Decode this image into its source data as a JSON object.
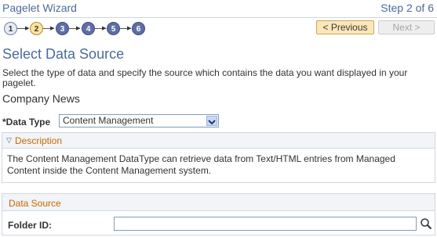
{
  "header": {
    "title": "Pagelet Wizard",
    "step_indicator": "Step 2 of 6"
  },
  "steps": [
    {
      "number": "1",
      "state": "done"
    },
    {
      "number": "2",
      "state": "current"
    },
    {
      "number": "3",
      "state": "todo"
    },
    {
      "number": "4",
      "state": "todo"
    },
    {
      "number": "5",
      "state": "todo"
    },
    {
      "number": "6",
      "state": "todo"
    }
  ],
  "nav": {
    "previous_label": "< Previous",
    "next_label": "Next >"
  },
  "page": {
    "title": "Select Data Source",
    "instructions": "Select the type of data and specify the source which contains the data you want displayed in your pagelet.",
    "pagelet_name": "Company News"
  },
  "data_type": {
    "label": "*Data Type",
    "value": "Content Management"
  },
  "description": {
    "title": "Description",
    "text": "The Content Management DataType can retrieve data from Text/HTML entries from Managed Content inside the Content Management system."
  },
  "data_source": {
    "title": "Data Source",
    "folder_label": "Folder ID:",
    "folder_value": ""
  },
  "icons": {
    "lookup": "magnifier-icon",
    "collapse": "triangle-down-icon",
    "dropdown": "chevron-down-icon"
  },
  "colors": {
    "title_blue": "#4b6b9a",
    "section_orange": "#cc6600",
    "current_step": "#fbe3a0",
    "pending_step": "#5d6fa5"
  }
}
